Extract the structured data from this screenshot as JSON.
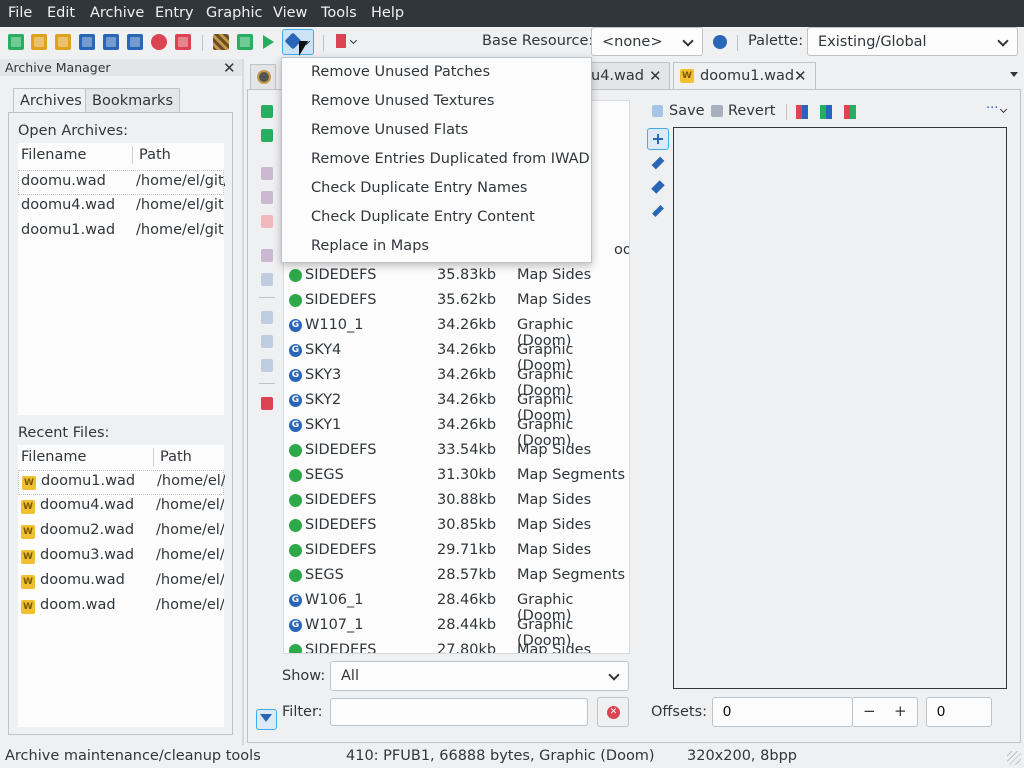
{
  "menu": [
    "File",
    "Edit",
    "Archive",
    "Entry",
    "Graphic",
    "View",
    "Tools",
    "Help"
  ],
  "toolbar": {
    "base_resource_label": "Base Resource:",
    "base_resource_value": "<none>",
    "palette_label": "Palette:",
    "palette_value": "Existing/Global"
  },
  "archive_manager": {
    "title": "Archive Manager",
    "tabs": [
      "Archives",
      "Bookmarks"
    ],
    "open_archives_label": "Open Archives:",
    "columns": [
      "Filename",
      "Path"
    ],
    "open_archives": [
      {
        "filename": "doomu.wad",
        "path": "/home/el/git/l"
      },
      {
        "filename": "doomu4.wad",
        "path": "/home/el/git/l"
      },
      {
        "filename": "doomu1.wad",
        "path": "/home/el/git/l"
      }
    ],
    "recent_files_label": "Recent Files:",
    "recent_files": [
      {
        "filename": "doomu1.wad",
        "path": "/home/el/g"
      },
      {
        "filename": "doomu4.wad",
        "path": "/home/el/g"
      },
      {
        "filename": "doomu2.wad",
        "path": "/home/el/g"
      },
      {
        "filename": "doomu3.wad",
        "path": "/home/el/g"
      },
      {
        "filename": "doomu.wad",
        "path": "/home/el/g"
      },
      {
        "filename": "doom.wad",
        "path": "/home/el/g"
      }
    ]
  },
  "doc_tabs": [
    "u4.wad",
    "doomu1.wad"
  ],
  "context_menu": [
    "Remove Unused Patches",
    "Remove Unused Textures",
    "Remove Unused Flats",
    "Remove Entries Duplicated from IWAD",
    "Check Duplicate Entry Names",
    "Check Duplicate Entry Content",
    "Replace in Maps"
  ],
  "entries": [
    {
      "name": "",
      "size": "",
      "type": "oom)",
      "icon": "gfx"
    },
    {
      "name": "SIDEDEFS",
      "size": "35.83kb",
      "type": "Map Sides",
      "icon": "map"
    },
    {
      "name": "SIDEDEFS",
      "size": "35.62kb",
      "type": "Map Sides",
      "icon": "map"
    },
    {
      "name": "W110_1",
      "size": "34.26kb",
      "type": "Graphic (Doom)",
      "icon": "gfx"
    },
    {
      "name": "SKY4",
      "size": "34.26kb",
      "type": "Graphic (Doom)",
      "icon": "gfx"
    },
    {
      "name": "SKY3",
      "size": "34.26kb",
      "type": "Graphic (Doom)",
      "icon": "gfx"
    },
    {
      "name": "SKY2",
      "size": "34.26kb",
      "type": "Graphic (Doom)",
      "icon": "gfx"
    },
    {
      "name": "SKY1",
      "size": "34.26kb",
      "type": "Graphic (Doom)",
      "icon": "gfx"
    },
    {
      "name": "SIDEDEFS",
      "size": "33.54kb",
      "type": "Map Sides",
      "icon": "map"
    },
    {
      "name": "SEGS",
      "size": "31.30kb",
      "type": "Map Segments",
      "icon": "map"
    },
    {
      "name": "SIDEDEFS",
      "size": "30.88kb",
      "type": "Map Sides",
      "icon": "map"
    },
    {
      "name": "SIDEDEFS",
      "size": "30.85kb",
      "type": "Map Sides",
      "icon": "map"
    },
    {
      "name": "SIDEDEFS",
      "size": "29.71kb",
      "type": "Map Sides",
      "icon": "map"
    },
    {
      "name": "SEGS",
      "size": "28.57kb",
      "type": "Map Segments",
      "icon": "map"
    },
    {
      "name": "W106_1",
      "size": "28.46kb",
      "type": "Graphic (Doom)",
      "icon": "gfx"
    },
    {
      "name": "W107_1",
      "size": "28.44kb",
      "type": "Graphic (Doom)",
      "icon": "gfx"
    },
    {
      "name": "SIDEDEFS",
      "size": "27.80kb",
      "type": "Map Sides",
      "icon": "map"
    }
  ],
  "list_filter": {
    "show_label": "Show:",
    "show_value": "All",
    "filter_label": "Filter:",
    "filter_value": ""
  },
  "editor": {
    "save_label": "Save",
    "revert_label": "Revert",
    "more_label": "···",
    "offsets_label": "Offsets:",
    "offset_x": "0",
    "offset_y": "0",
    "minus": "−",
    "plus": "+"
  },
  "status": {
    "left": "Archive maintenance/cleanup tools",
    "middle": "410: PFUB1, 66888 bytes, Graphic (Doom)",
    "right": "320x200, 8bpp"
  }
}
